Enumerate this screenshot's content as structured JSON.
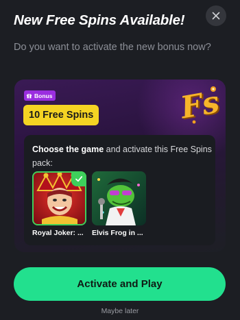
{
  "modal": {
    "title": "New Free Spins Available!",
    "subtitle": "Do you want to activate the new bonus now?"
  },
  "card": {
    "badge_label": "Bonus",
    "spins_label": "10 Free Spins",
    "logo_text": "Fs",
    "choose_bold": "Choose the game",
    "choose_rest": " and activate this Free Spins pack:",
    "games": [
      {
        "label": "Royal Joker: ...",
        "selected": true
      },
      {
        "label": "Elvis Frog in ...",
        "selected": false
      }
    ]
  },
  "actions": {
    "activate_label": "Activate and Play",
    "later_label": "Maybe later"
  },
  "colors": {
    "background": "#1c1e23",
    "accent_green": "#22e08e",
    "badge_purple": "#9b2ee0",
    "spins_yellow": "#f5d423",
    "selected_green": "#3ecf5b"
  },
  "icons": {
    "close": "close-icon",
    "gift": "gift-icon",
    "check": "check-icon"
  }
}
